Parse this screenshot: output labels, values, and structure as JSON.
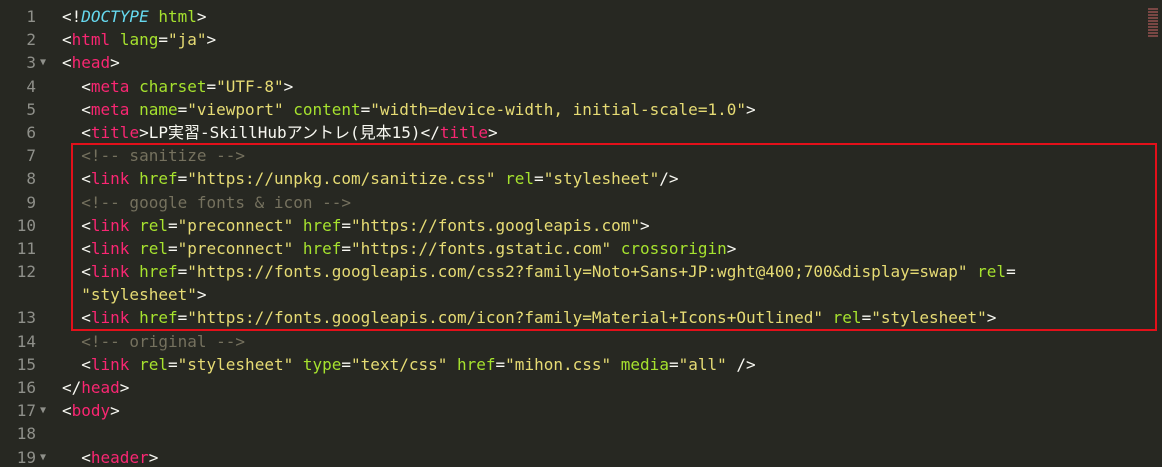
{
  "editor": {
    "lines": [
      {
        "num": "1",
        "fold": "",
        "tokens": [
          {
            "t": "punc",
            "v": "<!"
          },
          {
            "t": "doctype",
            "v": "DOCTYPE"
          },
          {
            "t": "punc",
            "v": " "
          },
          {
            "t": "attr",
            "v": "html"
          },
          {
            "t": "punc",
            "v": ">"
          }
        ]
      },
      {
        "num": "2",
        "fold": "",
        "tokens": [
          {
            "t": "punc",
            "v": "<"
          },
          {
            "t": "tag",
            "v": "html"
          },
          {
            "t": "punc",
            "v": " "
          },
          {
            "t": "attr",
            "v": "lang"
          },
          {
            "t": "punc",
            "v": "="
          },
          {
            "t": "str",
            "v": "\"ja\""
          },
          {
            "t": "punc",
            "v": ">"
          }
        ]
      },
      {
        "num": "3",
        "fold": "▼",
        "tokens": [
          {
            "t": "punc",
            "v": "<"
          },
          {
            "t": "tag",
            "v": "head"
          },
          {
            "t": "punc",
            "v": ">"
          }
        ]
      },
      {
        "num": "4",
        "fold": "",
        "tokens": [
          {
            "t": "punc",
            "v": "  <"
          },
          {
            "t": "tag",
            "v": "meta"
          },
          {
            "t": "punc",
            "v": " "
          },
          {
            "t": "attr",
            "v": "charset"
          },
          {
            "t": "punc",
            "v": "="
          },
          {
            "t": "str",
            "v": "\"UTF-8\""
          },
          {
            "t": "punc",
            "v": ">"
          }
        ]
      },
      {
        "num": "5",
        "fold": "",
        "tokens": [
          {
            "t": "punc",
            "v": "  <"
          },
          {
            "t": "tag",
            "v": "meta"
          },
          {
            "t": "punc",
            "v": " "
          },
          {
            "t": "attr",
            "v": "name"
          },
          {
            "t": "punc",
            "v": "="
          },
          {
            "t": "str",
            "v": "\"viewport\""
          },
          {
            "t": "punc",
            "v": " "
          },
          {
            "t": "attr",
            "v": "content"
          },
          {
            "t": "punc",
            "v": "="
          },
          {
            "t": "str",
            "v": "\"width=device-width, initial-scale=1.0\""
          },
          {
            "t": "punc",
            "v": ">"
          }
        ]
      },
      {
        "num": "6",
        "fold": "",
        "tokens": [
          {
            "t": "punc",
            "v": "  <"
          },
          {
            "t": "tag",
            "v": "title"
          },
          {
            "t": "punc",
            "v": ">LP実習-SkillHubアントレ(見本15)</"
          },
          {
            "t": "tag",
            "v": "title"
          },
          {
            "t": "punc",
            "v": ">"
          }
        ]
      },
      {
        "num": "7",
        "fold": "",
        "tokens": [
          {
            "t": "comment",
            "v": "  <!-- sanitize -->"
          }
        ]
      },
      {
        "num": "8",
        "fold": "",
        "tokens": [
          {
            "t": "punc",
            "v": "  <"
          },
          {
            "t": "tag",
            "v": "link"
          },
          {
            "t": "punc",
            "v": " "
          },
          {
            "t": "attr",
            "v": "href"
          },
          {
            "t": "punc",
            "v": "="
          },
          {
            "t": "str",
            "v": "\"https://unpkg.com/sanitize.css\""
          },
          {
            "t": "punc",
            "v": " "
          },
          {
            "t": "attr",
            "v": "rel"
          },
          {
            "t": "punc",
            "v": "="
          },
          {
            "t": "str",
            "v": "\"stylesheet\""
          },
          {
            "t": "punc",
            "v": "/>"
          }
        ]
      },
      {
        "num": "9",
        "fold": "",
        "tokens": [
          {
            "t": "comment",
            "v": "  <!-- google fonts & icon -->"
          }
        ]
      },
      {
        "num": "10",
        "fold": "",
        "tokens": [
          {
            "t": "punc",
            "v": "  <"
          },
          {
            "t": "tag",
            "v": "link"
          },
          {
            "t": "punc",
            "v": " "
          },
          {
            "t": "attr",
            "v": "rel"
          },
          {
            "t": "punc",
            "v": "="
          },
          {
            "t": "str",
            "v": "\"preconnect\""
          },
          {
            "t": "punc",
            "v": " "
          },
          {
            "t": "attr",
            "v": "href"
          },
          {
            "t": "punc",
            "v": "="
          },
          {
            "t": "str",
            "v": "\"https://fonts.googleapis.com\""
          },
          {
            "t": "punc",
            "v": ">"
          }
        ]
      },
      {
        "num": "11",
        "fold": "",
        "tokens": [
          {
            "t": "punc",
            "v": "  <"
          },
          {
            "t": "tag",
            "v": "link"
          },
          {
            "t": "punc",
            "v": " "
          },
          {
            "t": "attr",
            "v": "rel"
          },
          {
            "t": "punc",
            "v": "="
          },
          {
            "t": "str",
            "v": "\"preconnect\""
          },
          {
            "t": "punc",
            "v": " "
          },
          {
            "t": "attr",
            "v": "href"
          },
          {
            "t": "punc",
            "v": "="
          },
          {
            "t": "str",
            "v": "\"https://fonts.gstatic.com\""
          },
          {
            "t": "punc",
            "v": " "
          },
          {
            "t": "attr",
            "v": "crossorigin"
          },
          {
            "t": "punc",
            "v": ">"
          }
        ]
      },
      {
        "num": "12",
        "fold": "",
        "wrap": true,
        "tokens": [
          {
            "t": "punc",
            "v": "  <"
          },
          {
            "t": "tag",
            "v": "link"
          },
          {
            "t": "punc",
            "v": " "
          },
          {
            "t": "attr",
            "v": "href"
          },
          {
            "t": "punc",
            "v": "="
          },
          {
            "t": "str",
            "v": "\"https://fonts.googleapis.com/css2?family=Noto+Sans+JP:wght@400;700&display=swap\""
          },
          {
            "t": "punc",
            "v": " "
          },
          {
            "t": "attr",
            "v": "rel"
          },
          {
            "t": "punc",
            "v": "="
          }
        ],
        "tokens2": [
          {
            "t": "str",
            "v": "  \"stylesheet\""
          },
          {
            "t": "punc",
            "v": ">"
          }
        ]
      },
      {
        "num": "13",
        "fold": "",
        "tokens": [
          {
            "t": "punc",
            "v": "  <"
          },
          {
            "t": "tag",
            "v": "link"
          },
          {
            "t": "punc",
            "v": " "
          },
          {
            "t": "attr",
            "v": "href"
          },
          {
            "t": "punc",
            "v": "="
          },
          {
            "t": "str",
            "v": "\"https://fonts.googleapis.com/icon?family=Material+Icons+Outlined\""
          },
          {
            "t": "punc",
            "v": " "
          },
          {
            "t": "attr",
            "v": "rel"
          },
          {
            "t": "punc",
            "v": "="
          },
          {
            "t": "str",
            "v": "\"stylesheet\""
          },
          {
            "t": "punc",
            "v": ">"
          }
        ]
      },
      {
        "num": "14",
        "fold": "",
        "tokens": [
          {
            "t": "comment",
            "v": "  <!-- original -->"
          }
        ]
      },
      {
        "num": "15",
        "fold": "",
        "tokens": [
          {
            "t": "punc",
            "v": "  <"
          },
          {
            "t": "tag",
            "v": "link"
          },
          {
            "t": "punc",
            "v": " "
          },
          {
            "t": "attr",
            "v": "rel"
          },
          {
            "t": "punc",
            "v": "="
          },
          {
            "t": "str",
            "v": "\"stylesheet\""
          },
          {
            "t": "punc",
            "v": " "
          },
          {
            "t": "attr",
            "v": "type"
          },
          {
            "t": "punc",
            "v": "="
          },
          {
            "t": "str",
            "v": "\"text/css\""
          },
          {
            "t": "punc",
            "v": " "
          },
          {
            "t": "attr",
            "v": "href"
          },
          {
            "t": "punc",
            "v": "="
          },
          {
            "t": "str",
            "v": "\"mihon.css\""
          },
          {
            "t": "punc",
            "v": " "
          },
          {
            "t": "attr",
            "v": "media"
          },
          {
            "t": "punc",
            "v": "="
          },
          {
            "t": "str",
            "v": "\"all\""
          },
          {
            "t": "punc",
            "v": " />"
          }
        ]
      },
      {
        "num": "16",
        "fold": "",
        "tokens": [
          {
            "t": "punc",
            "v": "</"
          },
          {
            "t": "tag",
            "v": "head"
          },
          {
            "t": "punc",
            "v": ">"
          }
        ]
      },
      {
        "num": "17",
        "fold": "▼",
        "tokens": [
          {
            "t": "punc",
            "v": "<"
          },
          {
            "t": "tag",
            "v": "body"
          },
          {
            "t": "punc",
            "v": ">"
          }
        ]
      },
      {
        "num": "18",
        "fold": "",
        "tokens": []
      },
      {
        "num": "19",
        "fold": "▼",
        "tokens": [
          {
            "t": "punc",
            "v": "  <"
          },
          {
            "t": "tag",
            "v": "header"
          },
          {
            "t": "punc",
            "v": ">"
          }
        ]
      }
    ]
  },
  "colors": {
    "background": "#272822",
    "tag": "#f92672",
    "attribute": "#a6e22e",
    "string": "#e6db74",
    "keyword": "#66d9ef",
    "comment": "#75715e",
    "highlight_box": "#e3101a"
  }
}
